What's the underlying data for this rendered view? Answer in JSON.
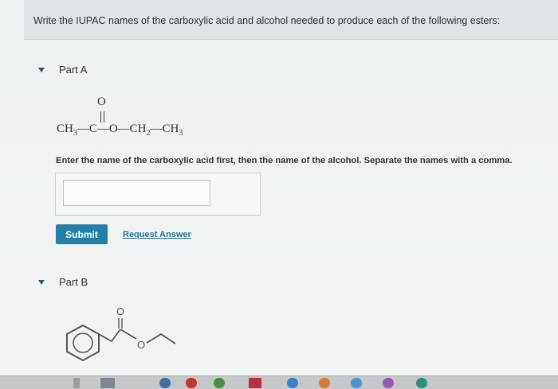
{
  "instruction": "Write the IUPAC names of the carboxylic acid and alcohol needed to produce each of the following esters:",
  "part_a": {
    "title": "Part A",
    "formula": {
      "oxygen_top": "O",
      "left": "CH",
      "left_sub": "3",
      "middle": "—C—O—CH",
      "middle_sub": "2",
      "right": "—CH",
      "right_sub": "3"
    },
    "prompt": "Enter the name of the carboxylic acid first, then the name of the alcohol. Separate the names with a comma.",
    "answer_value": "",
    "submit_label": "Submit",
    "request_answer_label": "Request Answer"
  },
  "part_b": {
    "title": "Part B",
    "structure_labels": {
      "carbonyl_oxygen": "O",
      "ester_oxygen": "O"
    }
  },
  "colors": {
    "accent": "#237fa8",
    "link": "#2b6f9b",
    "caret": "#31556f",
    "banner": "#dfe4e6"
  },
  "icons": [
    "caret-down-icon",
    "caret-down-icon"
  ]
}
